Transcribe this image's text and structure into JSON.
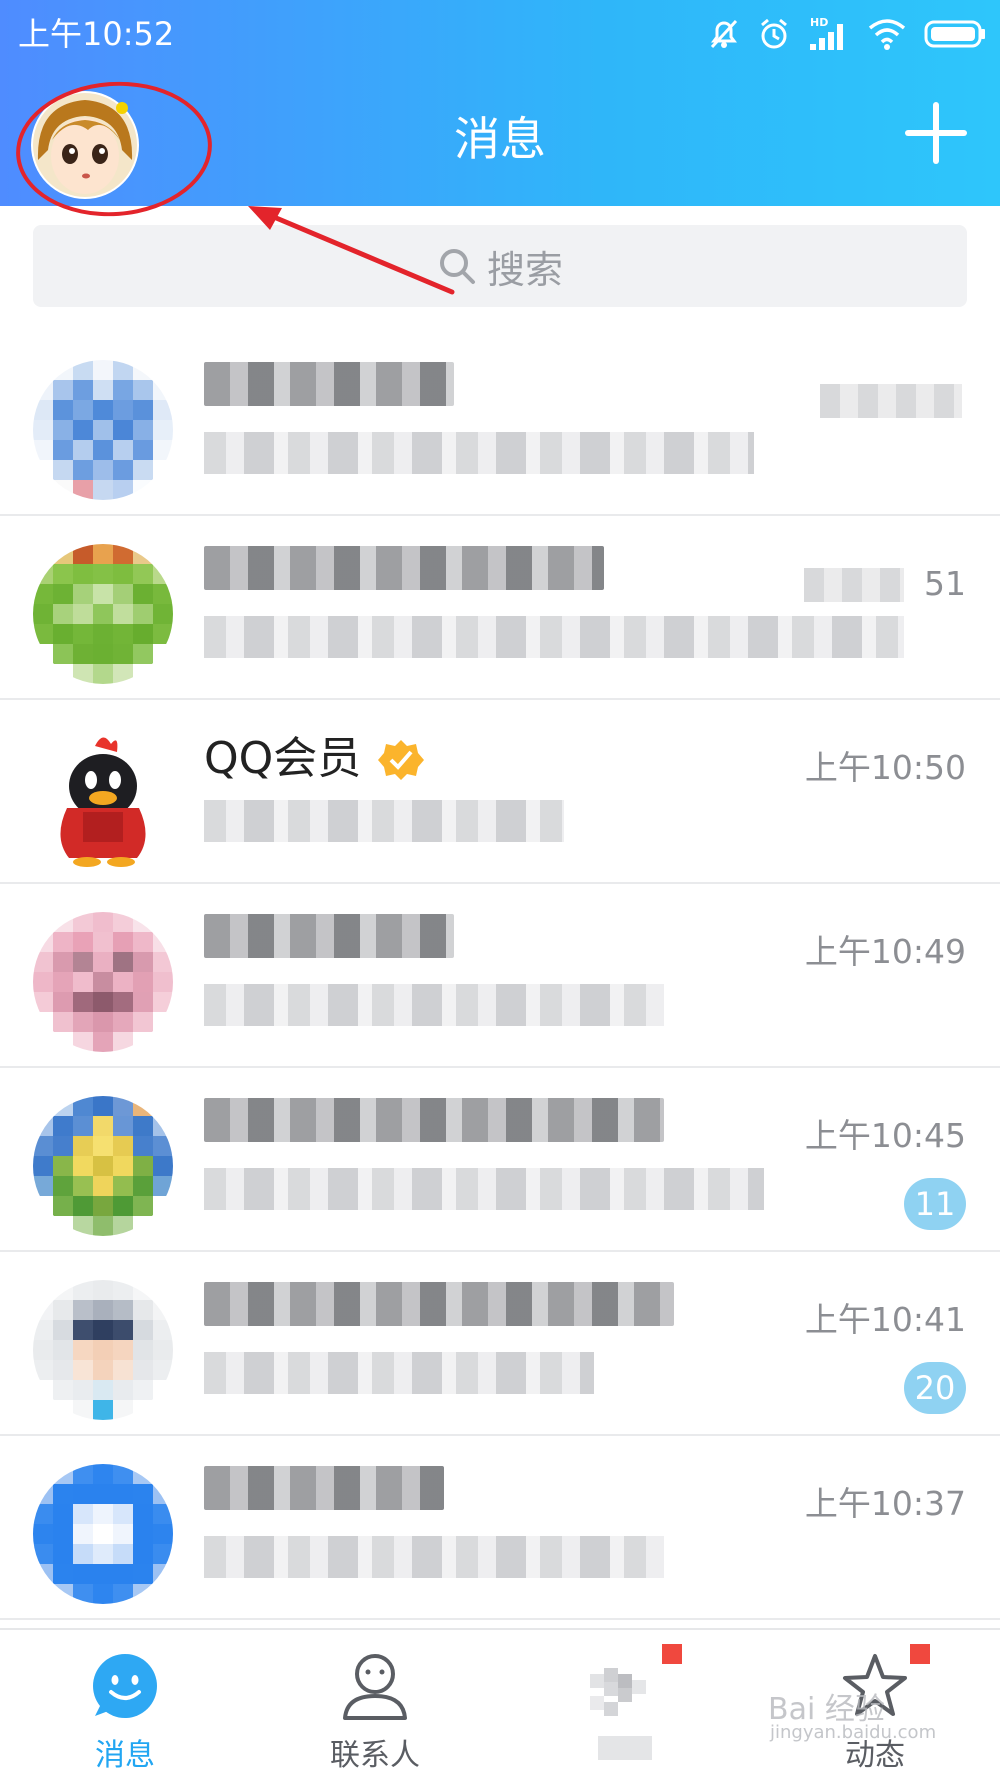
{
  "status_bar": {
    "time": "上午10:52",
    "icons": [
      "mute-icon",
      "alarm-icon",
      "hd-signal-icon",
      "wifi-icon",
      "battery-icon"
    ],
    "signal_label": "HD"
  },
  "header": {
    "title": "消息",
    "add_icon": "plus-icon"
  },
  "search": {
    "placeholder": "搜索"
  },
  "conversations": [
    {
      "name": "",
      "time": "",
      "badge": "",
      "name_width": 250,
      "msg_width": 550
    },
    {
      "name": "",
      "time": "51",
      "badge": "",
      "name_width": 400,
      "msg_width": 700
    },
    {
      "name": "QQ会员",
      "time": "上午10:50",
      "badge": "",
      "msg_width": 360
    },
    {
      "name": "",
      "time": "上午10:49",
      "badge": "",
      "name_width": 250,
      "msg_width": 460
    },
    {
      "name": "",
      "time": "上午10:45",
      "badge": "11",
      "name_width": 460,
      "msg_width": 560
    },
    {
      "name": "",
      "time": "上午10:41",
      "badge": "20",
      "name_width": 470,
      "msg_width": 390
    },
    {
      "name": "",
      "time": "上午10:37",
      "badge": "",
      "name_width": 240,
      "msg_width": 460
    }
  ],
  "bottom_nav": [
    {
      "label": "消息",
      "icon": "message-smile-icon",
      "active": true
    },
    {
      "label": "联系人",
      "icon": "contacts-icon",
      "active": false
    },
    {
      "label": "",
      "icon": "blurred-tab-icon",
      "active": false
    },
    {
      "label": "动态",
      "icon": "star-icon",
      "active": false
    }
  ],
  "watermark": {
    "text": "Bai 经验",
    "sub": "jingyan.baidu.com"
  },
  "colors": {
    "header_gradient_start": "#4f8cff",
    "header_gradient_end": "#2ec6fb",
    "annotation": "#e3242b",
    "badge": "#8fd2f2",
    "active_tab": "#22a6f2"
  }
}
